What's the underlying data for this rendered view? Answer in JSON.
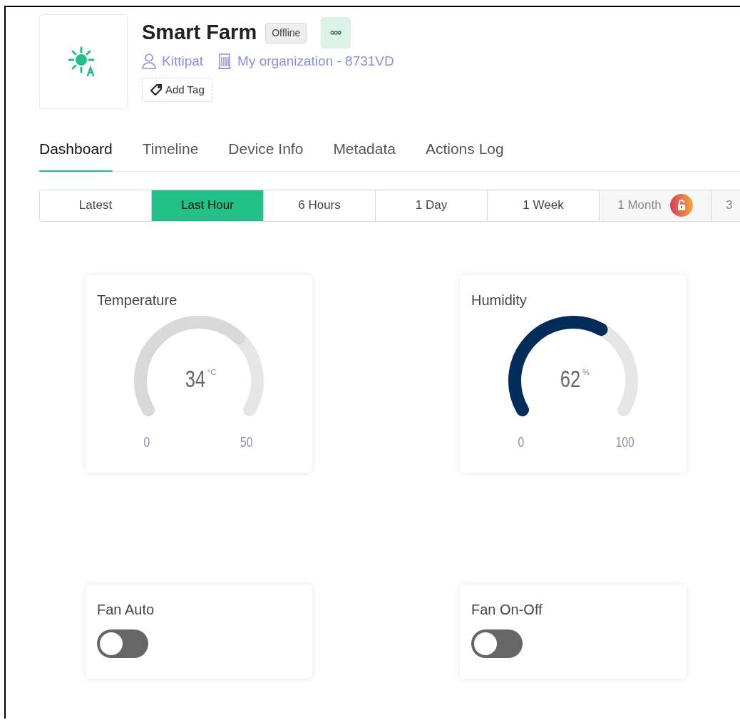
{
  "device": {
    "name": "Smart Farm",
    "status": "Offline",
    "owner": "Kittipat",
    "organization": "My organization - 8731VD",
    "add_tag": "Add Tag"
  },
  "tabs": [
    {
      "label": "Dashboard",
      "selected": true
    },
    {
      "label": "Timeline",
      "selected": false
    },
    {
      "label": "Device Info",
      "selected": false
    },
    {
      "label": "Metadata",
      "selected": false
    },
    {
      "label": "Actions Log",
      "selected": false
    }
  ],
  "time_ranges": [
    {
      "label": "Latest",
      "selected": false,
      "locked": false,
      "badge": false
    },
    {
      "label": "Last Hour",
      "selected": true,
      "locked": false,
      "badge": false
    },
    {
      "label": "6 Hours",
      "selected": false,
      "locked": false,
      "badge": false
    },
    {
      "label": "1 Day",
      "selected": false,
      "locked": false,
      "badge": false
    },
    {
      "label": "1 Week",
      "selected": false,
      "locked": false,
      "badge": false
    },
    {
      "label": "1 Month",
      "selected": false,
      "locked": true,
      "badge": true
    },
    {
      "label": "3",
      "selected": false,
      "locked": true,
      "badge": false
    }
  ],
  "widgets": [
    {
      "kind": "gauge",
      "title": "Temperature",
      "value": "34",
      "unit": "°C",
      "min": "0",
      "max": "50",
      "color": "#d9d9d9"
    },
    {
      "kind": "gauge",
      "title": "Humidity",
      "value": "62",
      "unit": "%",
      "min": "0",
      "max": "100",
      "color": "#022c5a"
    },
    {
      "kind": "switch",
      "title": "Fan Auto",
      "on": false
    },
    {
      "kind": "switch",
      "title": "Fan On-Off",
      "on": false
    }
  ]
}
